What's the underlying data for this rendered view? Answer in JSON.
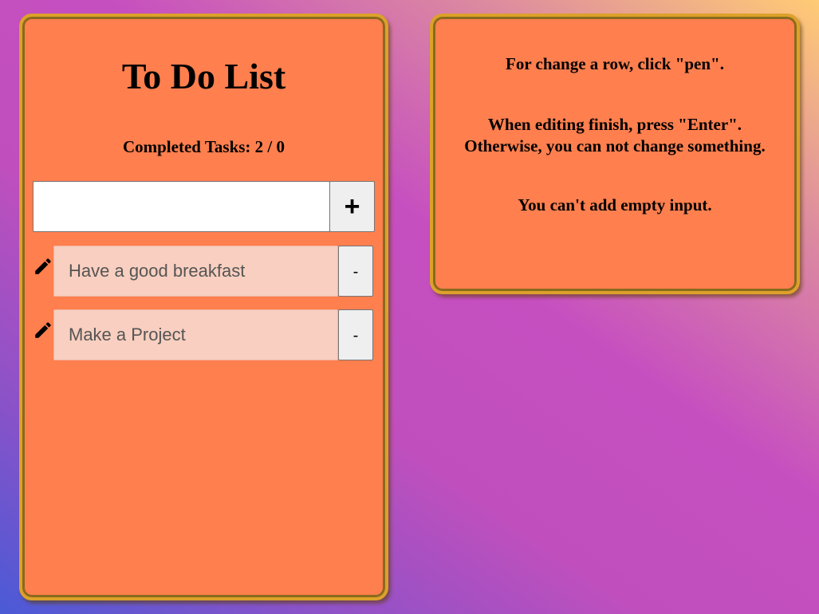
{
  "todo": {
    "title": "To Do List",
    "counter": "Completed Tasks: 2 / 0",
    "input": {
      "value": "",
      "placeholder": ""
    },
    "add_label": "+",
    "tasks": [
      {
        "text": "Have a good breakfast",
        "remove_label": "-",
        "edit_icon": "pen-icon"
      },
      {
        "text": "Make a Project",
        "remove_label": "-",
        "edit_icon": "pen-icon"
      }
    ]
  },
  "help": {
    "line1": "For change a row, click \"pen\".",
    "line2": "When editing finish, press \"Enter\".",
    "line3": "Otherwise, you can not change something.",
    "line4": "You can't add empty input."
  },
  "colors": {
    "panel_bg": "#ff7f4e",
    "panel_border": "#dca12a",
    "task_bg": "#f8cfc0",
    "button_bg": "#efefef"
  }
}
